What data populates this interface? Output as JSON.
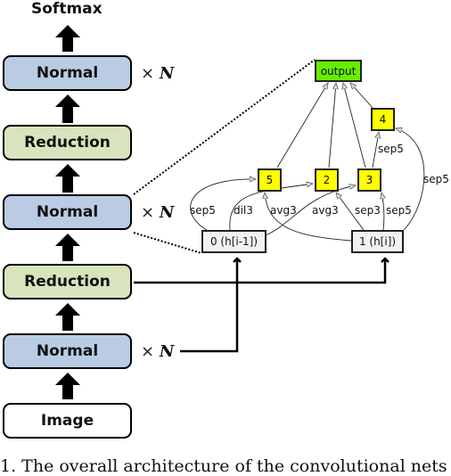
{
  "figure": {
    "top_label": "Softmax",
    "stack": [
      {
        "label": "Normal",
        "type": "normal",
        "repeat": "× N"
      },
      {
        "label": "Reduction",
        "type": "reduction"
      },
      {
        "label": "Normal",
        "type": "normal",
        "repeat": "× N"
      },
      {
        "label": "Reduction",
        "type": "reduction"
      },
      {
        "label": "Normal",
        "type": "normal",
        "repeat": "× N"
      },
      {
        "label": "Image",
        "type": "image"
      }
    ],
    "repeat_symbol": "×",
    "repeat_var": "N",
    "colors": {
      "normal": "#b9cce4",
      "reduction": "#d7e4bd",
      "op_node": "#ffff00",
      "output_node": "#66ee00",
      "input_node": "#f2f2f2"
    }
  },
  "cell": {
    "nodes": {
      "output": "output",
      "n4": "4",
      "n5": "5",
      "n2": "2",
      "n3": "3",
      "in0": "0 (h[i-1])",
      "in1": "1 (h[i])"
    },
    "edge_labels": {
      "e_0_5": "sep5",
      "e_0_2": "dil3",
      "e_1_5": "avg3",
      "e_0_3": "avg3",
      "e_1_2": "sep3",
      "e_1_3": "sep5",
      "e_3_4": "sep5",
      "e_1_4": "sep5"
    }
  },
  "caption": "1. The overall architecture of the convolutional nets"
}
